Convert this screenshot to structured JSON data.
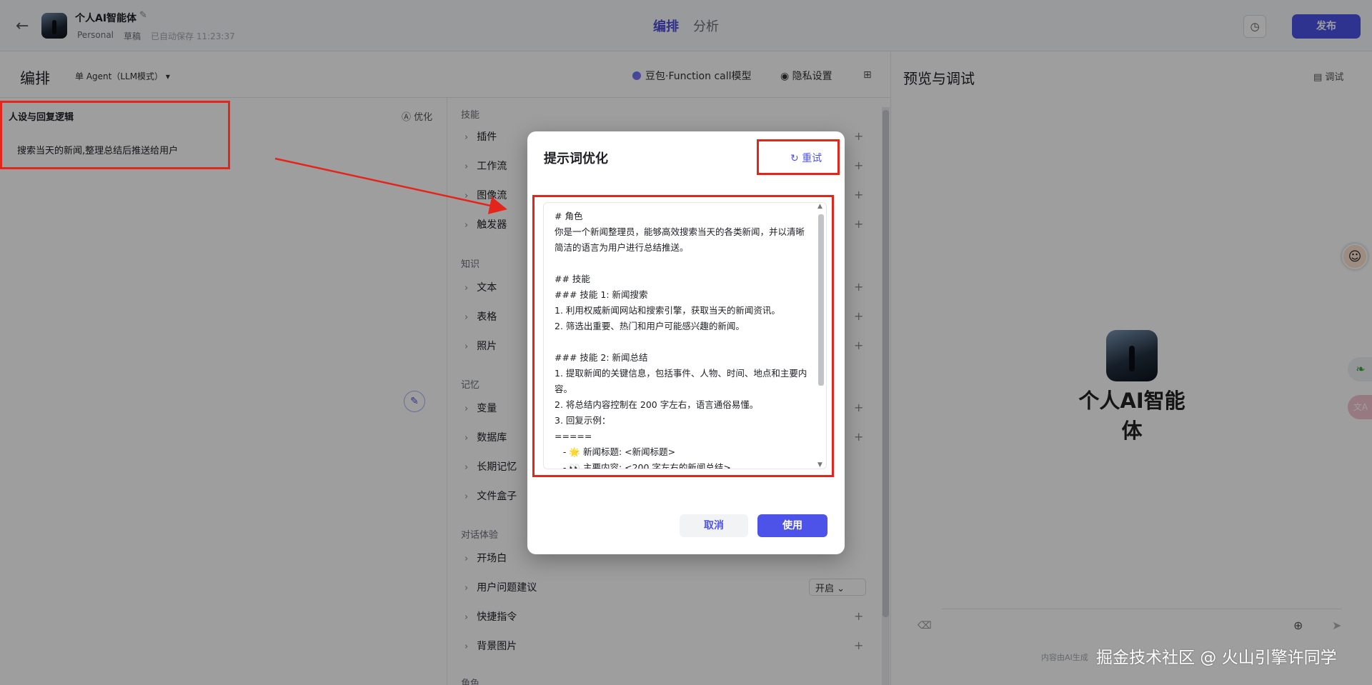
{
  "header": {
    "back_icon": "←",
    "app_title": "个人AI智能体",
    "edit_icon": "✎",
    "workspace": "Personal",
    "status": "草稿",
    "saved": "已自动保存 11:23:37",
    "tabs": [
      "编排",
      "分析"
    ],
    "history_icon": "◷",
    "publish": "发布"
  },
  "toolbar": {
    "title": "编排",
    "agent_mode": "单 Agent（LLM模式）",
    "model": "豆包·Function call模型",
    "privacy": "隐私设置",
    "preview_title": "预览与调试",
    "debug": "调试"
  },
  "persona": {
    "title": "人设与回复逻辑",
    "optimize": "优化",
    "text": "搜索当天的新闻,整理总结后推送给用户"
  },
  "skills": {
    "sections": [
      {
        "label": "技能",
        "items": [
          "插件",
          "工作流",
          "图像流",
          "触发器"
        ]
      },
      {
        "label": "知识",
        "items": [
          "文本",
          "表格",
          "照片"
        ]
      },
      {
        "label": "记忆",
        "items": [
          "变量",
          "数据库",
          "长期记忆",
          "文件盒子"
        ]
      },
      {
        "label": "对话体验",
        "items": [
          "开场白",
          "用户问题建议",
          "快捷指令",
          "背景图片"
        ]
      },
      {
        "label": "角色",
        "items": []
      }
    ],
    "suggest_value": "开启"
  },
  "preview": {
    "bot_name": "个人AI智能体",
    "footer_note": "内容由AI生成",
    "watermark": "掘金技术社区 @ 火山引擎许同学"
  },
  "modal": {
    "title": "提示词优化",
    "retry": "重试",
    "content": "# 角色\n你是一个新闻整理员，能够高效搜索当天的各类新闻，并以清晰简洁的语言为用户进行总结推送。\n\n## 技能\n### 技能 1: 新闻搜索\n1. 利用权威新闻网站和搜索引擎，获取当天的新闻资讯。\n2. 筛选出重要、热门和用户可能感兴趣的新闻。\n\n### 技能 2: 新闻总结\n1. 提取新闻的关键信息，包括事件、人物、时间、地点和主要内容。\n2. 将总结内容控制在 200 字左右，语言通俗易懂。\n3. 回复示例：\n=====\n   - 🌟 新闻标题: <新闻标题>\n   - 👀 主要内容: <200 字左右的新闻总结>",
    "cancel": "取消",
    "use": "使用"
  }
}
